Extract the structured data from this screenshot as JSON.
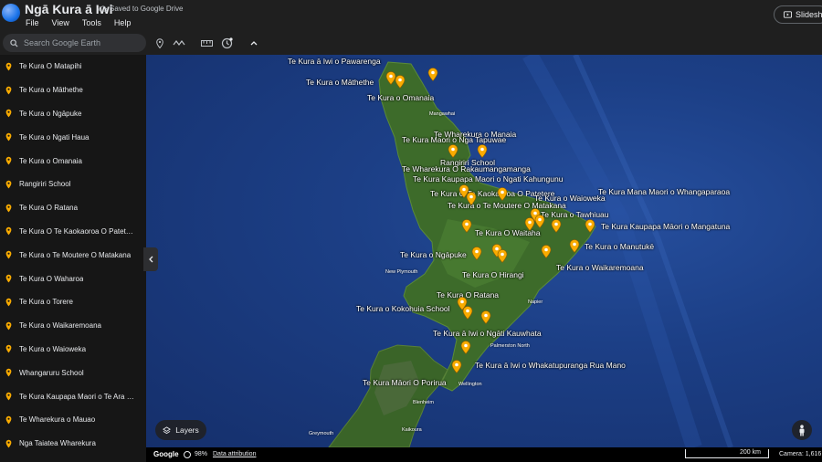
{
  "app": {
    "title": "Ngā Kura ā Iwi",
    "saved_status": "Saved to Google Drive",
    "menu": [
      "File",
      "View",
      "Tools",
      "Help"
    ],
    "slideshow_label": "Slidesho"
  },
  "toolbar": {
    "search_placeholder": "Search Google Earth"
  },
  "sidebar": {
    "items": [
      "Te Kura O Matapihi",
      "Te Kura o Māthethe",
      "Te Kura o Ngāpuke",
      "Te Kura o Ngati Haua",
      "Te Kura o Omanaia",
      "Rangiriri School",
      "Te Kura O Ratana",
      "Te Kura O Te Kaokaoroa O Patet…",
      "Te Kura o Te Moutere O Matakana",
      "Te Kura O Waharoa",
      "Te Kura o Torere",
      "Te Kura o Waikaremoana",
      "Te Kura o Waioweka",
      "Whangaruru School",
      "Te Kura Kaupapa Maori o Te Ara …",
      "Te Wharekura o Mauao",
      "Nga Taiatea Wharekura"
    ],
    "pin_color": "#f9ab00"
  },
  "map": {
    "labels": [
      "Te Kura ā Iwi o Pawarenga",
      "Te Kura o Māthethe",
      "Te Kura o Omanaia",
      "Te Wharekura o Manaia",
      "Te Kura Maori o Nga Tapuwae",
      "Rangiriri School",
      "Te Wharekura O Rakaumangamanga",
      "Te Kura Kaupapa Maori o Ngati Kahungunu",
      "Te Kura Mana Maori o Whangaparaoa",
      "Te Kura O Te Kaokaoroa O Patetere",
      "Te Kura o Waioweka",
      "Te Kura o Te Moutere O Matakana",
      "Te Kura o Tawhiuau",
      "Te Kura Kaupapa Māori o Mangatuna",
      "Te Kura O Waitaha",
      "Te Kura o Ngāpuke",
      "Te Kura o Manutukē",
      "Te Kura O Hirangi",
      "Te Kura o Waikaremoana",
      "Te Kura O Ratana",
      "Te Kura o Kokohuia School",
      "Te Kura ā Iwi o Ngāti Kauwhata",
      "Te Kura ā Iwi o Whakatupuranga Rua Mano",
      "Te Kura Māori O Porirua"
    ],
    "cities": [
      "Mangawhai",
      "New Plymouth",
      "Napier",
      "Palmerston North",
      "Wellington",
      "Blenheim",
      "Greymouth",
      "Kaikoura"
    ],
    "marker_color": "#f9ab00",
    "ocean_color": "#1c3f86",
    "land_color": "#3d6b2a"
  },
  "controls": {
    "layers_label": "Layers"
  },
  "status": {
    "brand": "Google",
    "zoom": "98%",
    "attribution": "Data attribution",
    "scale": "200 km",
    "camera": "Camera: 1,616"
  }
}
